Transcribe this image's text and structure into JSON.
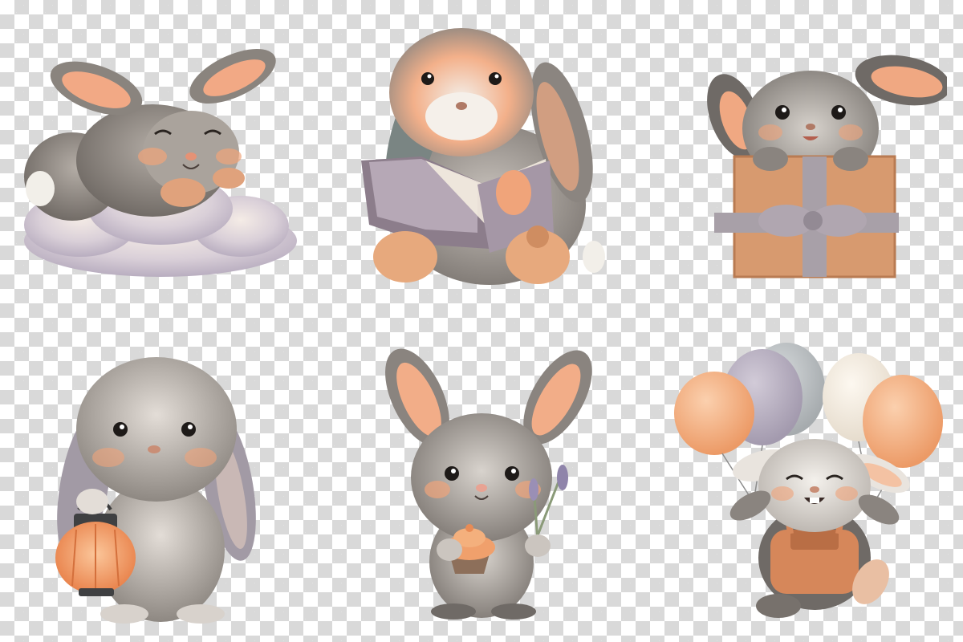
{
  "canvas": {
    "background": "transparency-checkerboard",
    "checker_light": "#ffffff",
    "checker_dark": "#d9d9d9"
  },
  "palette": {
    "fur_gray": "#9a9590",
    "fur_dark": "#6f6a66",
    "fur_light": "#e9e4de",
    "peach": "#f0a47a",
    "peach_soft": "#f6c6a6",
    "lavender": "#aaa1b4",
    "cream": "#f4ede2",
    "brown": "#c8865a",
    "eye": "#1e1a18"
  },
  "illustrations": [
    {
      "name": "sleeping-bunny-on-cloud"
    },
    {
      "name": "bunny-reading-book"
    },
    {
      "name": "bunny-in-gift-box"
    },
    {
      "name": "bunny-with-lantern"
    },
    {
      "name": "bunny-with-cupcake-and-lavender"
    },
    {
      "name": "bunny-with-balloons"
    }
  ]
}
